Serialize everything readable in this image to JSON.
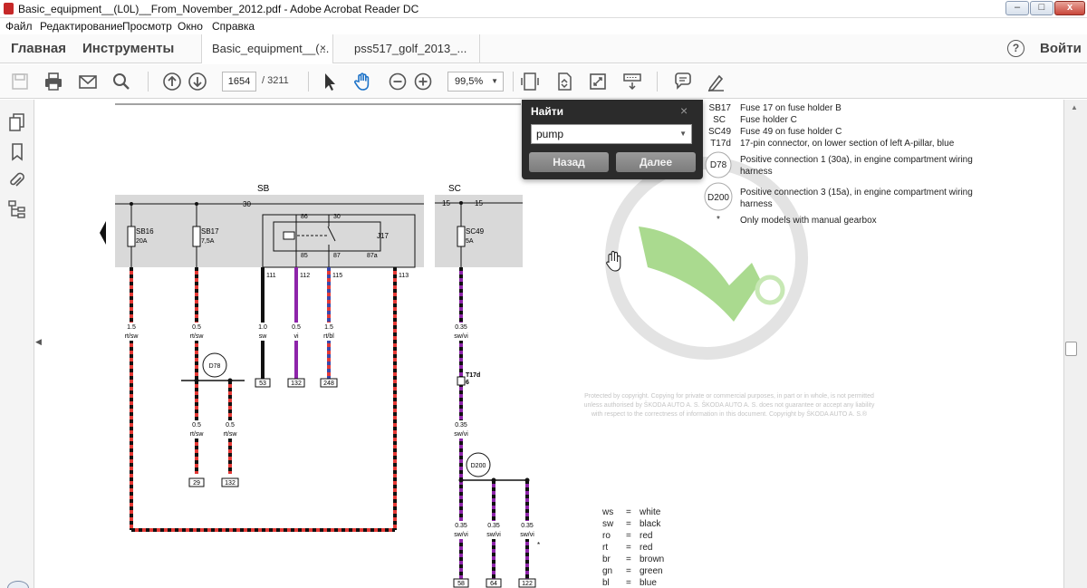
{
  "window": {
    "title": "Basic_equipment__(L0L)__From_November_2012.pdf - Adobe Acrobat Reader DC",
    "controls": [
      "–",
      "□",
      "x"
    ]
  },
  "menu": [
    "Файл",
    "Редактирование",
    "Просмотр",
    "Окно",
    "Справка"
  ],
  "tabs": {
    "home": "Главная",
    "tools": "Инструменты",
    "docs": [
      "Basic_equipment__(...",
      "pss517_golf_2013_..."
    ],
    "close_glyph": "×",
    "help": "?",
    "signin": "Войти"
  },
  "toolbar": {
    "page_current": "1654",
    "page_total": "/ 3211",
    "zoom": "99,5%",
    "icons": [
      "save-icon",
      "print-icon",
      "email-icon",
      "search-icon",
      "page-up-icon",
      "page-down-icon",
      "select-cursor-icon",
      "hand-tool-icon",
      "zoom-out-icon",
      "zoom-in-icon",
      "fit-page-icon",
      "rotate-icon",
      "fullscreen-icon",
      "scroll-mode-icon",
      "comment-icon",
      "sign-icon"
    ]
  },
  "leftnav": {
    "icons": [
      "pages-icon",
      "bookmark-icon",
      "attachment-icon",
      "structure-icon"
    ]
  },
  "find": {
    "title": "Найти",
    "close": "×",
    "query": "pump",
    "back": "Назад",
    "next": "Далее"
  },
  "legend_top": [
    {
      "code": "SB17",
      "text": "Fuse 17 on fuse holder B"
    },
    {
      "code": "SC",
      "text": "Fuse holder C"
    },
    {
      "code": "SC49",
      "text": "Fuse 49 on fuse holder C"
    },
    {
      "code": "T17d",
      "text": "17-pin connector, on lower section of left A-pillar, blue"
    },
    {
      "code": "D78",
      "text": "Positive connection 1 (30a), in engine compartment wiring",
      "text2": "harness"
    },
    {
      "code": "D200",
      "text": "Positive connection 3 (15a), in engine compartment wiring",
      "text2": "harness"
    },
    {
      "code": "*",
      "text": "Only models with manual gearbox"
    }
  ],
  "copyright": [
    "Protected by copyright. Copying for private or commercial purposes, in part or in whole, is not permitted",
    "unless authorised by ŠKODA AUTO A. S. ŠKODA AUTO A. S. does not guarantee or accept any liability",
    "with respect to the correctness of information in this document. Copyright by ŠKODA AUTO A. S.®"
  ],
  "color_codes": [
    {
      "c": "ws",
      "name": "white"
    },
    {
      "c": "sw",
      "name": "black"
    },
    {
      "c": "ro",
      "name": "red"
    },
    {
      "c": "rt",
      "name": "red"
    },
    {
      "c": "br",
      "name": "brown"
    },
    {
      "c": "gn",
      "name": "green"
    },
    {
      "c": "bl",
      "name": "blue"
    }
  ],
  "diagram": {
    "holder_sb": "SB",
    "holder_sc": "SC",
    "fuses": [
      {
        "name": "SB16",
        "rating": "20A"
      },
      {
        "name": "SB17",
        "rating": "7,5A"
      },
      {
        "name": "SC49",
        "rating": "5A"
      }
    ],
    "relay": "J17",
    "relay_pins": [
      "86",
      "30",
      "85",
      "87",
      "87a"
    ],
    "bus_labels": [
      "30",
      "15",
      "15"
    ],
    "pins": [
      "111",
      "112",
      "115",
      "113"
    ],
    "wire_labels": [
      "1.5",
      "rt/sw",
      "0.5",
      "rt/sw",
      "1.0",
      "sw",
      "0.5",
      "vi",
      "1.5",
      "rt/bl",
      "0.35",
      "sw/vi"
    ],
    "wire_labels_lower": [
      "0.5",
      "rt/sw",
      "0.5",
      "rt/sw",
      "0.35",
      "sw/vi"
    ],
    "wire_labels_bottom": [
      "0.35",
      "sw/vi",
      "0.35",
      "sw/vi",
      "0.35",
      "sw/vi"
    ],
    "terminals": [
      "53",
      "132",
      "248",
      "29",
      "132",
      "58",
      "64",
      "122"
    ],
    "connector": "T17d",
    "connector_pin": "6",
    "nodes": [
      "D78",
      "D200"
    ],
    "asterisk": "*"
  },
  "colors": {
    "wire_red": "#e53935",
    "wire_black": "#111111",
    "wire_violet": "#8e24aa",
    "wire_blue": "#3949ab",
    "holder_fill": "#d9d9d9",
    "logo": "#5fb935"
  }
}
